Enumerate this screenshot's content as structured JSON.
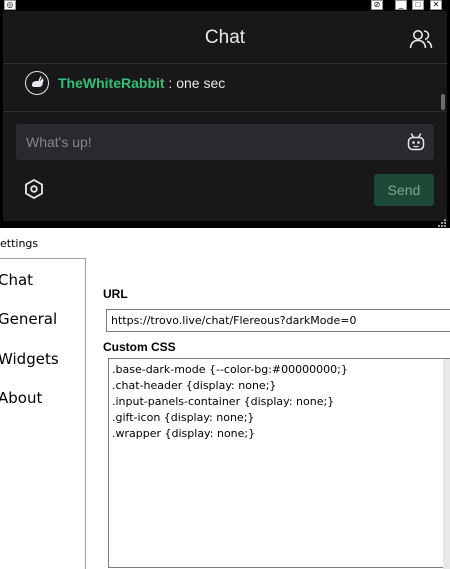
{
  "chat_window": {
    "title": "Chat",
    "message": {
      "username": "TheWhiteRabbit",
      "separator": " : ",
      "text": "one sec"
    },
    "input_placeholder": "What's up!",
    "send_label": "Send",
    "icons": {
      "users": "users-icon",
      "emote": "emote-robot-icon",
      "settings": "hexagon-settings-icon",
      "avatar": "rabbit-avatar-icon"
    },
    "colors": {
      "background": "#18181b",
      "username": "#35c073",
      "send_button": "#1d4a37"
    }
  },
  "settings_window": {
    "title": "ettings",
    "nav": [
      {
        "label": "Chat"
      },
      {
        "label": "General"
      },
      {
        "label": "Widgets"
      },
      {
        "label": "About"
      }
    ],
    "url_label": "URL",
    "url_value": "https://trovo.live/chat/Flereous?darkMode=0",
    "css_label": "Custom CSS",
    "css_lines": [
      ".base-dark-mode {--color-bg:#00000000;}",
      ".chat-header {display: none;}",
      ".input-panels-container {display: none;}",
      ".gift-icon {display: none;}",
      ".wrapper {display: none;}"
    ]
  }
}
